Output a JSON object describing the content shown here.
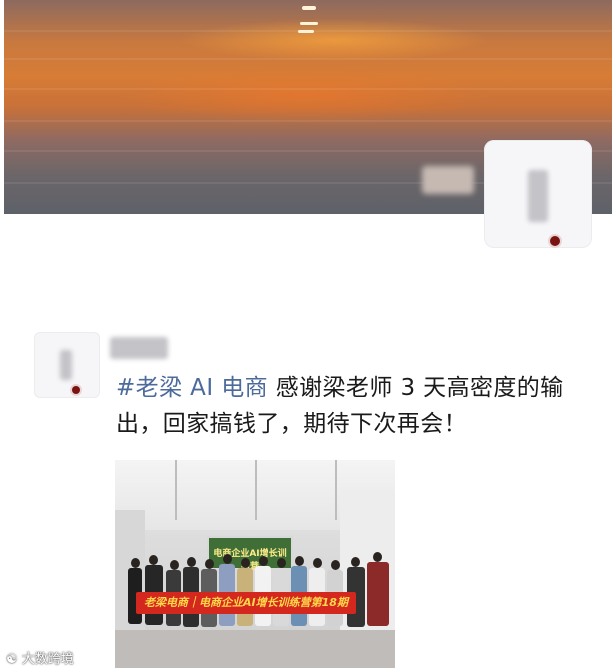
{
  "post": {
    "hashtag": "#老梁 AI 电商",
    "text": " 感谢梁老师 3 天高密度的输出，回家搞钱了，期待下次再会！"
  },
  "photo": {
    "banner": "老梁电商｜电商企业AI增长训练营第18期",
    "screen_text": "电商企业AI增长训练营"
  },
  "watermark": {
    "text": "大数跨境"
  },
  "colors": {
    "hashtag": "#4c6a9a",
    "banner_bg": "#d4271e",
    "banner_text": "#ffd84a"
  }
}
